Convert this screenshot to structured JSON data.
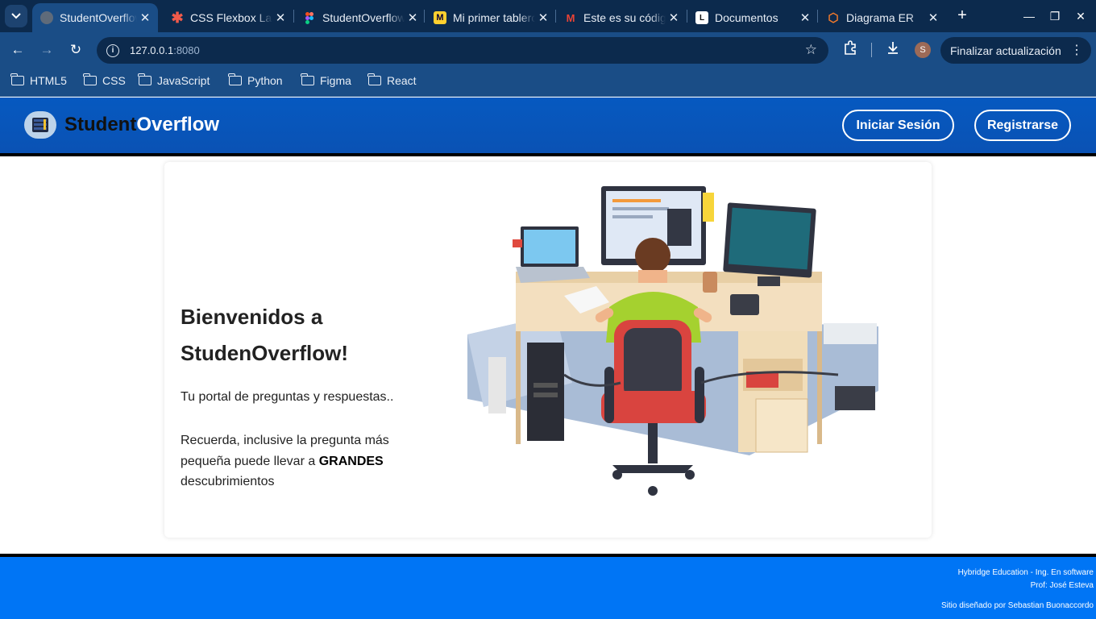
{
  "browser": {
    "tabs": [
      {
        "title": "StudentOverflow",
        "active": true
      },
      {
        "title": "CSS Flexbox Layout"
      },
      {
        "title": "StudentOverflow"
      },
      {
        "title": "Mi primer tablero"
      },
      {
        "title": "Este es su código"
      },
      {
        "title": "Documentos"
      },
      {
        "title": "Diagrama ER"
      }
    ],
    "url_host": "127.0.0.1",
    "url_port": ":8080",
    "update_button": "Finalizar actualización",
    "profile_initial": "S",
    "bookmarks": [
      "HTML5",
      "CSS",
      "JavaScript",
      "Python",
      "Figma",
      "React"
    ]
  },
  "header": {
    "brand_part1": "Student",
    "brand_part2": "Overflow",
    "login_label": "Iniciar Sesión",
    "register_label": "Registrarse"
  },
  "hero": {
    "title": "Bienvenidos a StudenOverflow!",
    "tagline": "Tu portal de preguntas y respuestas..",
    "message_before": "Recuerda, inclusive la pregunta más pequeña puede llevar a ",
    "message_bold": "GRANDES",
    "message_after": " descubrimientos"
  },
  "footer": {
    "line1": "Hybridge Education - Ing. En software",
    "line2": "Prof: José Esteva",
    "line3": "Sitio diseñado por Sebastian Buonaccordo"
  },
  "colors": {
    "chrome_dark": "#0c2a4d",
    "chrome_mid": "#1a4d86",
    "header_blue": "#0659c0",
    "footer_blue": "#0075f5"
  }
}
